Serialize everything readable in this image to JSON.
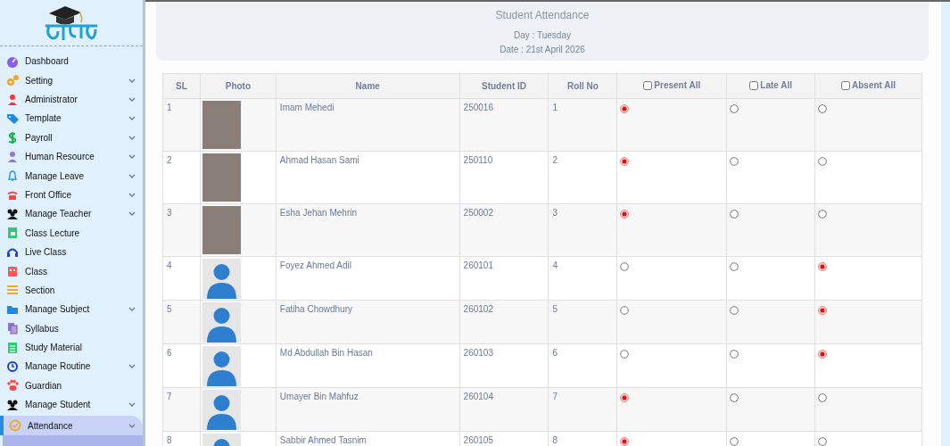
{
  "sidebar": {
    "items": [
      {
        "label": "Dashboard",
        "has_submenu": false,
        "selected": false
      },
      {
        "label": "Setting",
        "has_submenu": true,
        "selected": false
      },
      {
        "label": "Administrator",
        "has_submenu": true,
        "selected": false
      },
      {
        "label": "Template",
        "has_submenu": true,
        "selected": false
      },
      {
        "label": "Payroll",
        "has_submenu": true,
        "selected": false
      },
      {
        "label": "Human Resource",
        "has_submenu": true,
        "selected": false
      },
      {
        "label": "Manage Leave",
        "has_submenu": true,
        "selected": false
      },
      {
        "label": "Front Office",
        "has_submenu": true,
        "selected": false
      },
      {
        "label": "Manage Teacher",
        "has_submenu": true,
        "selected": false
      },
      {
        "label": "Class Lecture",
        "has_submenu": false,
        "selected": false
      },
      {
        "label": "Live Class",
        "has_submenu": false,
        "selected": false
      },
      {
        "label": "Class",
        "has_submenu": false,
        "selected": false
      },
      {
        "label": "Section",
        "has_submenu": false,
        "selected": false
      },
      {
        "label": "Manage Subject",
        "has_submenu": true,
        "selected": false
      },
      {
        "label": "Syllabus",
        "has_submenu": false,
        "selected": false
      },
      {
        "label": "Study Material",
        "has_submenu": false,
        "selected": false
      },
      {
        "label": "Manage Routine",
        "has_submenu": true,
        "selected": false
      },
      {
        "label": "Guardian",
        "has_submenu": false,
        "selected": false
      },
      {
        "label": "Manage Student",
        "has_submenu": true,
        "selected": false
      },
      {
        "label": "Attendance",
        "has_submenu": true,
        "selected": true
      }
    ]
  },
  "header": {
    "title": "Student Attendance",
    "day": "Day : Tuesday",
    "date": "Date : 21st April 2026"
  },
  "table": {
    "columns": [
      {
        "label": "SL"
      },
      {
        "label": "Photo"
      },
      {
        "label": "Name"
      },
      {
        "label": "Student ID"
      },
      {
        "label": "Roll No"
      },
      {
        "label": "Present All",
        "checked": false
      },
      {
        "label": "Late All",
        "checked": false
      },
      {
        "label": "Absent All",
        "checked": false
      }
    ],
    "rows": [
      {
        "sl": "1",
        "kind": "photo",
        "name": "Imam Mehedi",
        "student_id": "250016",
        "roll": "1",
        "marks": [
          {
            "selected": true
          },
          {
            "selected": false
          },
          {
            "selected": false
          }
        ]
      },
      {
        "sl": "2",
        "kind": "photo",
        "name": "Ahmad Hasan Sami",
        "student_id": "250110",
        "roll": "2",
        "marks": [
          {
            "selected": true
          },
          {
            "selected": false
          },
          {
            "selected": false
          }
        ]
      },
      {
        "sl": "3",
        "kind": "photo",
        "name": "Esha Jehan Mehrin",
        "student_id": "250002",
        "roll": "3",
        "marks": [
          {
            "selected": true
          },
          {
            "selected": false
          },
          {
            "selected": false
          }
        ]
      },
      {
        "sl": "4",
        "kind": "avatar",
        "name": "Foyez Ahmed Adil",
        "student_id": "260101",
        "roll": "4",
        "marks": [
          {
            "selected": false
          },
          {
            "selected": false
          },
          {
            "selected": true
          }
        ]
      },
      {
        "sl": "5",
        "kind": "avatar",
        "name": "Fatiha Chowdhury",
        "student_id": "260102",
        "roll": "5",
        "marks": [
          {
            "selected": false
          },
          {
            "selected": false
          },
          {
            "selected": true
          }
        ]
      },
      {
        "sl": "6",
        "kind": "avatar",
        "name": "Md Abdullah Bin Hasan",
        "student_id": "260103",
        "roll": "6",
        "marks": [
          {
            "selected": false
          },
          {
            "selected": false
          },
          {
            "selected": true
          }
        ]
      },
      {
        "sl": "7",
        "kind": "avatar",
        "name": "Umayer Bin Mahfuz",
        "student_id": "260104",
        "roll": "7",
        "marks": [
          {
            "selected": true
          },
          {
            "selected": false
          },
          {
            "selected": false
          }
        ]
      },
      {
        "sl": "8",
        "kind": "avatar",
        "name": "Sabbir Ahmed Tasnim",
        "student_id": "260105",
        "roll": "8",
        "marks": [
          {
            "selected": true
          },
          {
            "selected": false
          },
          {
            "selected": false
          }
        ]
      }
    ]
  }
}
